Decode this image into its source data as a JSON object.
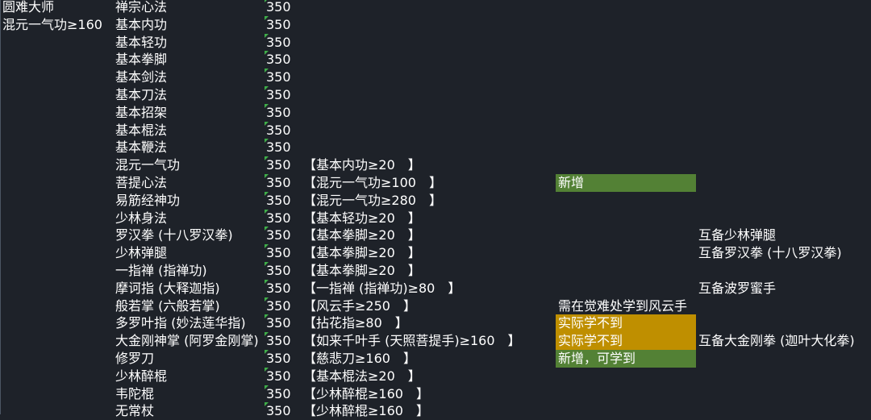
{
  "colors": {
    "background": "#1e2229",
    "text": "#ffffff",
    "highlight_green": "#538135",
    "highlight_gold": "#bf8f00",
    "comment_marker": "#3fae49"
  },
  "rows": [
    {
      "master": "圆难大师",
      "skill": "禅宗心法",
      "level": "350",
      "req": "",
      "note": "",
      "note_style": "",
      "remark": ""
    },
    {
      "master": "混元一气功≥160",
      "skill": "基本内功",
      "level": "350",
      "req": "",
      "note": "",
      "note_style": "",
      "remark": ""
    },
    {
      "master": "",
      "skill": "基本轻功",
      "level": "350",
      "req": "",
      "note": "",
      "note_style": "",
      "remark": ""
    },
    {
      "master": "",
      "skill": "基本拳脚",
      "level": "350",
      "req": "",
      "note": "",
      "note_style": "",
      "remark": ""
    },
    {
      "master": "",
      "skill": "基本剑法",
      "level": "350",
      "req": "",
      "note": "",
      "note_style": "",
      "remark": ""
    },
    {
      "master": "",
      "skill": "基本刀法",
      "level": "350",
      "req": "",
      "note": "",
      "note_style": "",
      "remark": ""
    },
    {
      "master": "",
      "skill": "基本招架",
      "level": "350",
      "req": "",
      "note": "",
      "note_style": "",
      "remark": ""
    },
    {
      "master": "",
      "skill": "基本棍法",
      "level": "350",
      "req": "",
      "note": "",
      "note_style": "",
      "remark": ""
    },
    {
      "master": "",
      "skill": "基本鞭法",
      "level": "350",
      "req": "",
      "note": "",
      "note_style": "",
      "remark": ""
    },
    {
      "master": "",
      "skill": "混元一气功",
      "level": "350",
      "req": "【基本内功≥20　】",
      "note": "",
      "note_style": "",
      "remark": ""
    },
    {
      "master": "",
      "skill": "菩提心法",
      "level": "350",
      "req": "【混元一气功≥100　】",
      "note": "新增",
      "note_style": "green",
      "remark": ""
    },
    {
      "master": "",
      "skill": "易筋经神功",
      "level": "350",
      "req": "【混元一气功≥280　】",
      "note": "",
      "note_style": "",
      "remark": ""
    },
    {
      "master": "",
      "skill": "少林身法",
      "level": "350",
      "req": "【基本轻功≥20　】",
      "note": "",
      "note_style": "",
      "remark": ""
    },
    {
      "master": "",
      "skill": "罗汉拳 (十八罗汉拳)",
      "level": "350",
      "req": "【基本拳脚≥20　】",
      "note": "",
      "note_style": "",
      "remark": "互备少林弹腿"
    },
    {
      "master": "",
      "skill": "少林弹腿",
      "level": "350",
      "req": "【基本拳脚≥20　】",
      "note": "",
      "note_style": "",
      "remark": "互备罗汉拳 (十八罗汉拳)"
    },
    {
      "master": "",
      "skill": "一指禅 (指禅功)",
      "level": "350",
      "req": "【基本拳脚≥20　】",
      "note": "",
      "note_style": "",
      "remark": ""
    },
    {
      "master": "",
      "skill": "摩诃指 (大释迦指)",
      "level": "350",
      "req": "【一指禅 (指禅功)≥80　】",
      "note": "",
      "note_style": "",
      "remark": "互备波罗蜜手"
    },
    {
      "master": "",
      "skill": "般若掌 (六般若掌)",
      "level": "350",
      "req": "【风云手≥250　】",
      "note": "需在觉难处学到风云手",
      "note_style": "",
      "remark": ""
    },
    {
      "master": "",
      "skill": "多罗叶指 (妙法莲华指)",
      "level": "350",
      "req": "【拈花指≥80　】",
      "note": "实际学不到",
      "note_style": "gold",
      "remark": ""
    },
    {
      "master": "",
      "skill": "大金刚神掌 (阿罗金刚掌)",
      "level": "350",
      "req": "【如来千叶手 (天照菩提手)≥160　】",
      "note": "实际学不到",
      "note_style": "gold",
      "remark": "互备大金刚拳 (迦叶大化拳)"
    },
    {
      "master": "",
      "skill": "修罗刀",
      "level": "350",
      "req": "【慈悲刀≥160　】",
      "note": "新增，可学到",
      "note_style": "green",
      "remark": ""
    },
    {
      "master": "",
      "skill": "少林醉棍",
      "level": "350",
      "req": "【基本棍法≥20　】",
      "note": "",
      "note_style": "",
      "remark": ""
    },
    {
      "master": "",
      "skill": "韦陀棍",
      "level": "350",
      "req": "【少林醉棍≥160　】",
      "note": "",
      "note_style": "",
      "remark": ""
    },
    {
      "master": "",
      "skill": "无常杖",
      "level": "350",
      "req": "【少林醉棍≥160　】",
      "note": "",
      "note_style": "",
      "remark": ""
    }
  ]
}
